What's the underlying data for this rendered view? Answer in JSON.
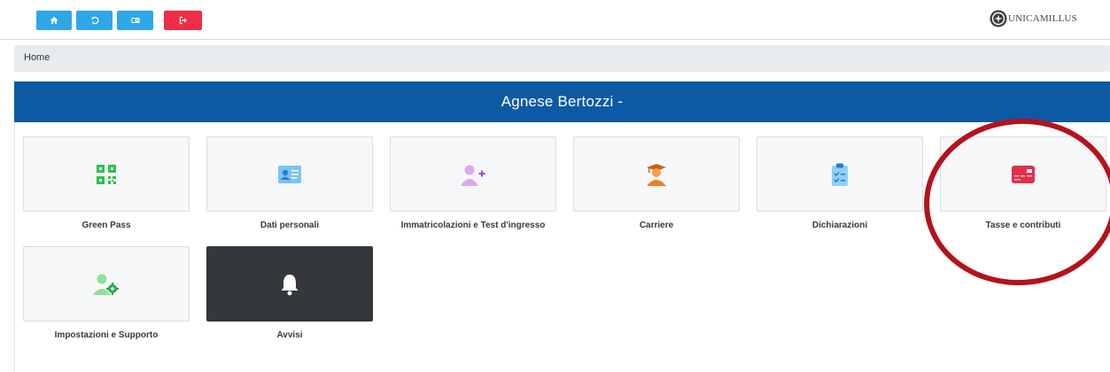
{
  "toolbar": {
    "buttons": [
      {
        "name": "home-button",
        "icon": "home-icon",
        "color": "#2ea7e7"
      },
      {
        "name": "back-button",
        "icon": "undo-icon",
        "color": "#2ea7e7"
      },
      {
        "name": "switch-button",
        "icon": "id-card-icon",
        "color": "#2ea7e7"
      },
      {
        "name": "logout-button",
        "icon": "sign-out-icon",
        "color": "#ee2e48"
      }
    ],
    "logo_text": "UNICAMILLUS"
  },
  "breadcrumb": {
    "label": "Home"
  },
  "header": {
    "title": "Agnese Bertozzi -",
    "color": "#0d5aa4"
  },
  "tiles": [
    {
      "label": "Green Pass",
      "icon": "qr-code-icon",
      "icon_color": "#2fbf4f"
    },
    {
      "label": "Dati personali",
      "icon": "id-card-icon",
      "icon_color": "#4aa8ea"
    },
    {
      "label": "Immatricolazioni e Test d'ingresso",
      "icon": "user-plus-icon",
      "icon_color": "#b774d9"
    },
    {
      "label": "Carriere",
      "icon": "graduate-icon",
      "icon_color": "#ef7f1f"
    },
    {
      "label": "Dichiarazioni",
      "icon": "clipboard-check-icon",
      "icon_color": "#62b8ea"
    },
    {
      "label": "Tasse e contributi",
      "icon": "credit-card-icon",
      "icon_color": "#e0314a"
    },
    {
      "label": "Impostazioni e Supporto",
      "icon": "user-gear-icon",
      "icon_color": "#5fcf70"
    },
    {
      "label": "Avvisi",
      "icon": "bell-icon",
      "icon_color": "#ffffff"
    }
  ],
  "annotation": {
    "color": "#b5121b",
    "target": "Tasse e contributi"
  }
}
